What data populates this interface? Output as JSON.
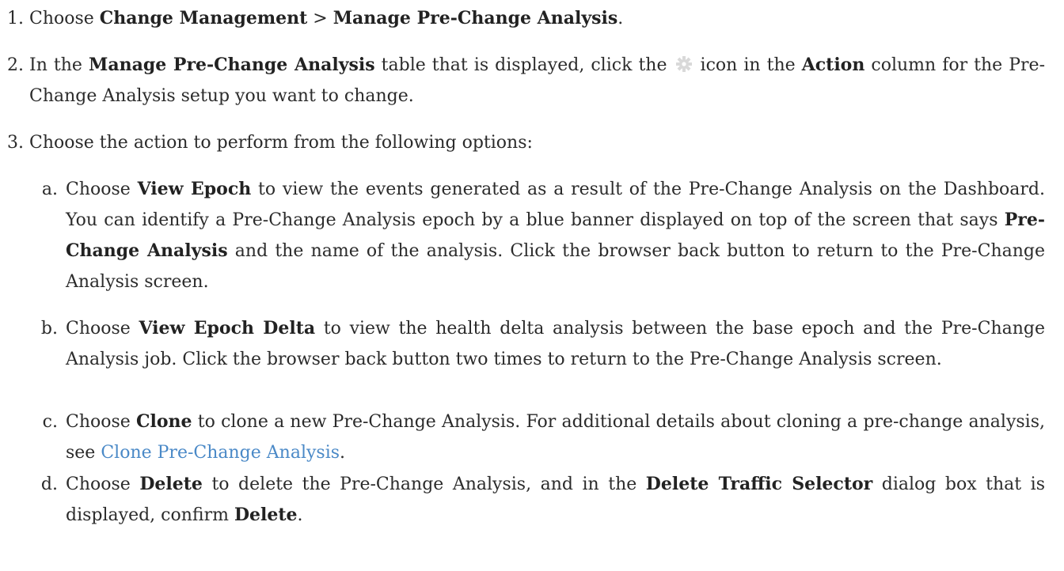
{
  "steps": [
    {
      "num": "1.",
      "t1": "Choose ",
      "b1": "Change Management",
      "t2": " > ",
      "b2": "Manage Pre-Change Analysis",
      "t3": "."
    },
    {
      "num": "2.",
      "t1": "In the ",
      "b1": "Manage Pre-Change Analysis",
      "t2": " table that is displayed, click the ",
      "icon": "gear-icon",
      "t3": " icon in the ",
      "b2": "Action",
      "t4": " column for the Pre-Change Analysis setup you want to change."
    },
    {
      "num": "3.",
      "t1": "Choose the action to perform from the following options:"
    }
  ],
  "substeps": [
    {
      "num": "a.",
      "t1": "Choose ",
      "b1": "View Epoch",
      "t2": " to view the events generated as a result of the Pre-Change Analysis on the Dashboard. You can identify a Pre-Change Analysis epoch by a blue banner displayed on top of the screen that says ",
      "b2": "Pre-Change Analysis",
      "t3": " and the name of the analysis. Click the browser back button to return to the Pre-Change Analysis screen."
    },
    {
      "num": "b.",
      "t1": "Choose ",
      "b1": "View Epoch Delta",
      "t2": " to view the health delta analysis between the base epoch and the Pre-Change Analysis job. Click the browser back button two times to return to the Pre-Change Analysis screen."
    },
    {
      "num": "c.",
      "t1": "Choose ",
      "b1": "Clone",
      "t2": " to clone a new Pre-Change Analysis. For additional details about cloning a pre-change analysis, see ",
      "link": "Clone Pre-Change Analysis",
      "t3": "."
    },
    {
      "num": "d.",
      "t1": "Choose ",
      "b1": "Delete",
      "t2": " to delete the Pre-Change Analysis, and in the ",
      "b2": "Delete Traffic Selector",
      "t3": " dialog box that is displayed, confirm ",
      "b3": "Delete",
      "t4": "."
    }
  ],
  "colors": {
    "text": "#2b2b2b",
    "link": "#4a89c7",
    "gear_icon": "#d9d9d9"
  }
}
